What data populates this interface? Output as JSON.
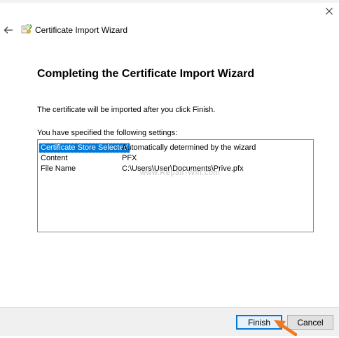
{
  "wizard": {
    "title": "Certificate Import Wizard",
    "heading": "Completing the Certificate Import Wizard",
    "description": "The certificate will be imported after you click Finish.",
    "settings_label": "You have specified the following settings:"
  },
  "settings": [
    {
      "name": "Certificate Store Selected",
      "value": "Automatically determined by the wizard"
    },
    {
      "name": "Content",
      "value": "PFX"
    },
    {
      "name": "File Name",
      "value": "C:\\Users\\User\\Documents\\Prive.pfx"
    }
  ],
  "watermark": "www.Repair-Win.com",
  "buttons": {
    "finish": "Finish",
    "cancel": "Cancel"
  },
  "icons": {
    "close": "close-icon",
    "back": "back-arrow-icon",
    "wizard": "certificate-icon",
    "pointer": "arrow-pointer-icon"
  },
  "colors": {
    "selection": "#0078d7",
    "annotation_arrow": "#f0781e",
    "footer": "#f0f0f0"
  }
}
